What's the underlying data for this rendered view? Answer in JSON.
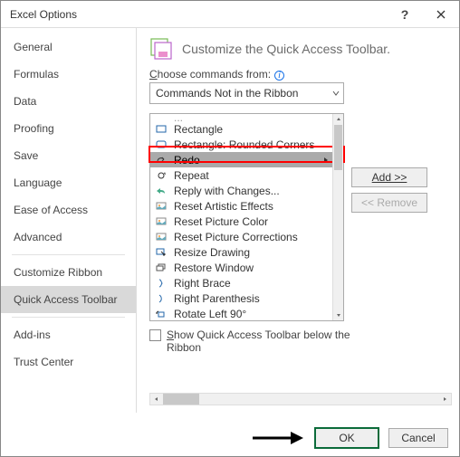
{
  "window": {
    "title": "Excel Options"
  },
  "sidebar": {
    "items": [
      "General",
      "Formulas",
      "Data",
      "Proofing",
      "Save",
      "Language",
      "Ease of Access",
      "Advanced",
      "Customize Ribbon",
      "Quick Access Toolbar",
      "Add-ins",
      "Trust Center"
    ],
    "selected_index": 9
  },
  "header": {
    "text": "Customize the Quick Access Toolbar."
  },
  "choose_label_pre": "C",
  "choose_label_rest": "hoose commands from:",
  "dropdown": {
    "value": "Commands Not in the Ribbon"
  },
  "commands": [
    "Rectangle",
    "Rectangle: Rounded Corners",
    "Redo",
    "Repeat",
    "Reply with Changes...",
    "Reset Artistic Effects",
    "Reset Picture Color",
    "Reset Picture Corrections",
    "Resize Drawing",
    "Restore Window",
    "Right Brace",
    "Right Parenthesis",
    "Rotate Left 90°"
  ],
  "highlighted_index": 2,
  "add_button": "Add >>",
  "remove_button": "<< Remove",
  "checkbox_label_pre": "S",
  "checkbox_label_rest": "how Quick Access Toolbar below the Ribbon",
  "ok": "OK",
  "cancel": "Cancel"
}
